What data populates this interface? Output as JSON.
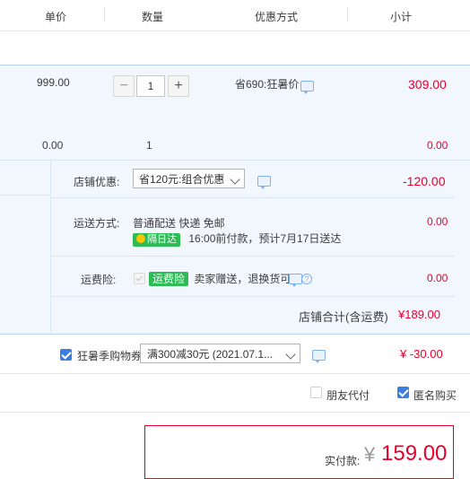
{
  "header": {
    "col_price": "单价",
    "col_qty": "数量",
    "col_promo": "优惠方式",
    "col_subtotal": "小计"
  },
  "item": {
    "unit_price": "999.00",
    "qty": "1",
    "promo": "省690:狂暑价",
    "subtotal": "309.00"
  },
  "gift": {
    "unit_price": "0.00",
    "qty": "1",
    "subtotal": "0.00"
  },
  "shop_discount": {
    "label": "店铺优惠:",
    "selected": "省120元:组合优惠",
    "amount": "-120.00"
  },
  "shipping": {
    "label": "运送方式:",
    "method": "普通配送 快递 免邮",
    "badge": "隔日达",
    "note": "16:00前付款，预计7月17日送达",
    "amount": "0.00"
  },
  "insurance": {
    "label": "运费险:",
    "tag": "运费险",
    "desc": "卖家赠送，退换货可赔",
    "amount": "0.00"
  },
  "shop_total": {
    "label": "店铺合计(含运费)",
    "amount": "¥189.00"
  },
  "coupon": {
    "label": "狂暑季购物券",
    "selected": "满300减30元 (2021.07.1...",
    "amount": "¥ -30.00"
  },
  "options": {
    "friend_pay": "朋友代付",
    "anonymous": "匿名购买"
  },
  "payment": {
    "label": "实付款:",
    "currency": "¥",
    "amount": "159.00"
  },
  "colors": {
    "accent_red": "#e8002c",
    "accent_blue": "#3a7ee4",
    "band_bg": "#f2f6fd",
    "badge_green": "#2dbb55"
  }
}
